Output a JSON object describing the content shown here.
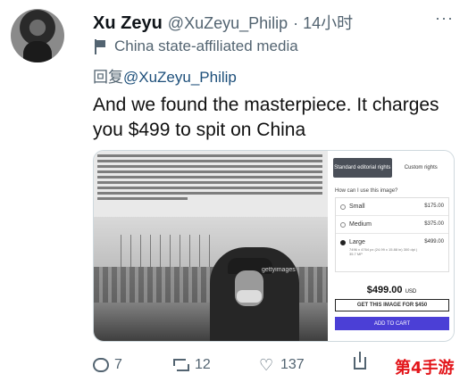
{
  "tweet": {
    "author_name": "Xu Zeyu",
    "author_handle": "@XuZeyu_Philip",
    "time": "· 14小时",
    "more": "···",
    "label_text": "China state-affiliated media",
    "reply_prefix": "回复",
    "reply_to": "@XuZeyu_Philip",
    "text": "And we found the masterpiece. It charges you $499 to spit on China"
  },
  "media": {
    "photo_credit": "gettyimages",
    "panel": {
      "tab_standard": "Standard editorial rights",
      "tab_custom": "Custom rights",
      "usage_question": "How can I use this image?",
      "sizes": [
        {
          "name": "Small",
          "price": "$175.00",
          "selected": false
        },
        {
          "name": "Medium",
          "price": "$375.00",
          "selected": false
        },
        {
          "name": "Large",
          "price": "$499.00",
          "selected": true,
          "dims": "7496 x 4764 px (24.99 x 15.88 in) 300 dpi | 35.7 MP"
        }
      ],
      "total_price": "$499.00",
      "currency": "USD",
      "buy_label": "GET THIS IMAGE FOR $450",
      "cart_label": "ADD TO CART"
    }
  },
  "actions": {
    "replies": "7",
    "retweets": "12",
    "likes": "137"
  },
  "watermark": {
    "prefix": "第4",
    "suffix": "手游"
  }
}
